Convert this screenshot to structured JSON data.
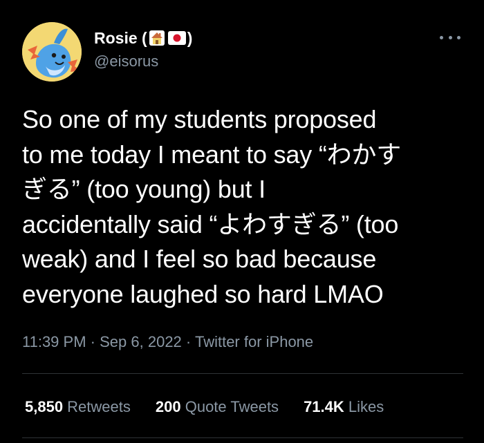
{
  "author": {
    "display_name_prefix": "Rosie (",
    "display_name_suffix": ")",
    "name_emojis": [
      "house-emoji",
      "japan-flag-emoji"
    ],
    "handle": "@eisorus",
    "avatar_icon": "mudkip-avatar-icon"
  },
  "more_icon": "more-options-icon",
  "tweet": {
    "text": "So one of my students proposed\nto me today I meant to say “わかす\nぎる” (too young) but I\naccidentally said “よわすぎる” (too\nweak) and I feel so bad because\neveryone laughed so hard LMAO"
  },
  "meta": {
    "time": "11:39 PM",
    "separator": "·",
    "date": "Sep 6, 2022",
    "source": "Twitter for iPhone"
  },
  "stats": {
    "retweets_count": "5,850",
    "retweets_label": "Retweets",
    "quotes_count": "200",
    "quotes_label": "Quote Tweets",
    "likes_count": "71.4K",
    "likes_label": "Likes"
  },
  "colors": {
    "background": "#000000",
    "primary_text": "#ffffff",
    "secondary_text": "#8b98a5",
    "divider": "#2f3336",
    "avatar_bg": "#f3d873"
  }
}
